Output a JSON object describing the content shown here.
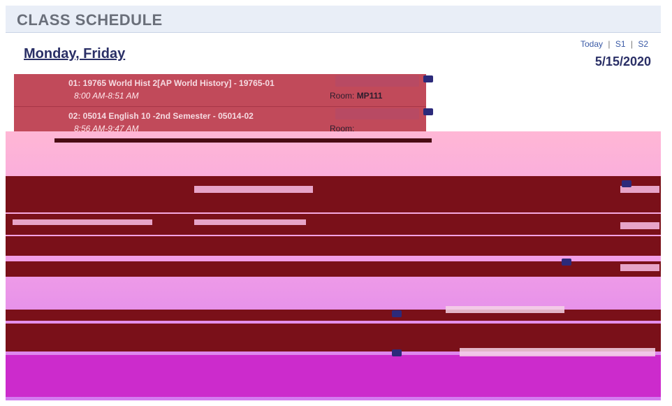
{
  "header": {
    "title": "CLASS SCHEDULE",
    "day_heading": "Monday, Friday",
    "term_links": [
      "Today",
      "S1",
      "S2"
    ],
    "date": "5/15/2020"
  },
  "periods": [
    {
      "course": "01: 19765 World Hist 2[AP World History] - 19765-01",
      "time": "8:00 AM-8:51 AM",
      "room_label": "Room:",
      "room": "MP111"
    },
    {
      "course": "02: 05014 English 10 -2nd Semester - 05014-02",
      "time": "8:56 AM-9:47 AM",
      "room_label": "Room:",
      "room": ""
    }
  ],
  "colors": {
    "header_bg": "#e9eef7",
    "period_bg": "#c14a5a",
    "accent_dark": "#7a1019",
    "canvas_pink": "#ffb7d5",
    "canvas_purple": "#d47cf0"
  },
  "icons": {
    "mail": "mail-icon"
  }
}
